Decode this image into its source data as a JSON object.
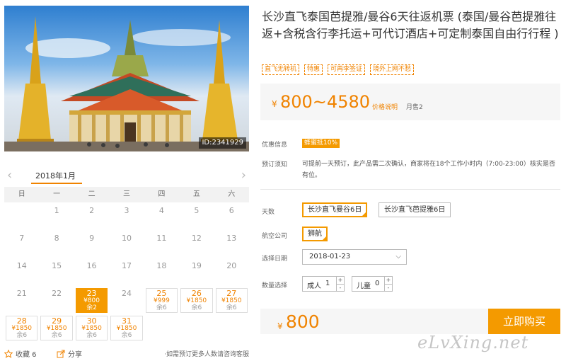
{
  "photo": {
    "id_label": "ID:2341929"
  },
  "calendar": {
    "month_label": "2018年1月",
    "prev_icon": "chevron-left-icon",
    "next_icon": "chevron-right-icon",
    "weekdays": [
      "日",
      "一",
      "二",
      "三",
      "四",
      "五",
      "六"
    ],
    "days": [
      {
        "day": "",
        "price": "",
        "stock": ""
      },
      {
        "day": "1",
        "price": "",
        "stock": ""
      },
      {
        "day": "2",
        "price": "",
        "stock": ""
      },
      {
        "day": "3",
        "price": "",
        "stock": ""
      },
      {
        "day": "4",
        "price": "",
        "stock": ""
      },
      {
        "day": "5",
        "price": "",
        "stock": ""
      },
      {
        "day": "6",
        "price": "",
        "stock": ""
      },
      {
        "day": "7",
        "price": "",
        "stock": ""
      },
      {
        "day": "8",
        "price": "",
        "stock": ""
      },
      {
        "day": "9",
        "price": "",
        "stock": ""
      },
      {
        "day": "10",
        "price": "",
        "stock": ""
      },
      {
        "day": "11",
        "price": "",
        "stock": ""
      },
      {
        "day": "12",
        "price": "",
        "stock": ""
      },
      {
        "day": "13",
        "price": "",
        "stock": ""
      },
      {
        "day": "14",
        "price": "",
        "stock": ""
      },
      {
        "day": "15",
        "price": "",
        "stock": ""
      },
      {
        "day": "16",
        "price": "",
        "stock": ""
      },
      {
        "day": "17",
        "price": "",
        "stock": ""
      },
      {
        "day": "18",
        "price": "",
        "stock": ""
      },
      {
        "day": "19",
        "price": "",
        "stock": ""
      },
      {
        "day": "20",
        "price": "",
        "stock": ""
      },
      {
        "day": "21",
        "price": "",
        "stock": ""
      },
      {
        "day": "22",
        "price": "",
        "stock": ""
      },
      {
        "day": "23",
        "price": "¥800",
        "stock": "余2",
        "selected": true
      },
      {
        "day": "24",
        "price": "",
        "stock": ""
      },
      {
        "day": "25",
        "price": "¥999",
        "stock": "余6"
      },
      {
        "day": "26",
        "price": "¥1850",
        "stock": "余6"
      },
      {
        "day": "27",
        "price": "¥1850",
        "stock": "余6"
      },
      {
        "day": "28",
        "price": "¥1850",
        "stock": "余6"
      },
      {
        "day": "29",
        "price": "¥1850",
        "stock": "余6"
      },
      {
        "day": "30",
        "price": "¥1850",
        "stock": "余6"
      },
      {
        "day": "31",
        "price": "¥1850",
        "stock": "余6"
      }
    ]
  },
  "actions": {
    "favorite_label": "收藏 6",
    "share_label": "分享",
    "contact_note": "如需预订更多人数请咨询客服"
  },
  "product": {
    "title": "长沙直飞泰国芭提雅/曼谷6天往返机票 (泰国/曼谷芭提雅往返+含税含行李托运+可代订酒店+可定制泰国自由行行程 )",
    "tags": [
      "直飞无转机",
      "特惠",
      "可再李签证",
      "境外上网不愁"
    ]
  },
  "price": {
    "currency": "¥",
    "range": "800~4580",
    "note": "价格说明",
    "sold": "月售2"
  },
  "offers": {
    "label": "优惠信息",
    "discount": "蜂蜜抵10%"
  },
  "notice": {
    "label": "预订须知",
    "text": "可提前一天预订，此产品需二次确认，商家将在18个工作小时内（7:00-23:00）核实是否有位。"
  },
  "options": {
    "package_label": "天数",
    "packages": [
      "长沙直飞曼谷6日",
      "长沙直飞芭提雅6日"
    ],
    "airline_label": "航空公司",
    "airline": "狮航",
    "date_label": "选择日期",
    "date_value": "2018-01-23",
    "qty_label": "数量选择",
    "adult_label": "成人",
    "adult_value": "1",
    "child_label": "儿童",
    "child_value": "0",
    "plus": "+",
    "minus": "-"
  },
  "buy": {
    "currency": "¥",
    "price": "800",
    "button_label": "立即购买"
  },
  "watermark": "eLvXing.net",
  "colors": {
    "accent": "#f49a00",
    "price": "#f08300"
  }
}
